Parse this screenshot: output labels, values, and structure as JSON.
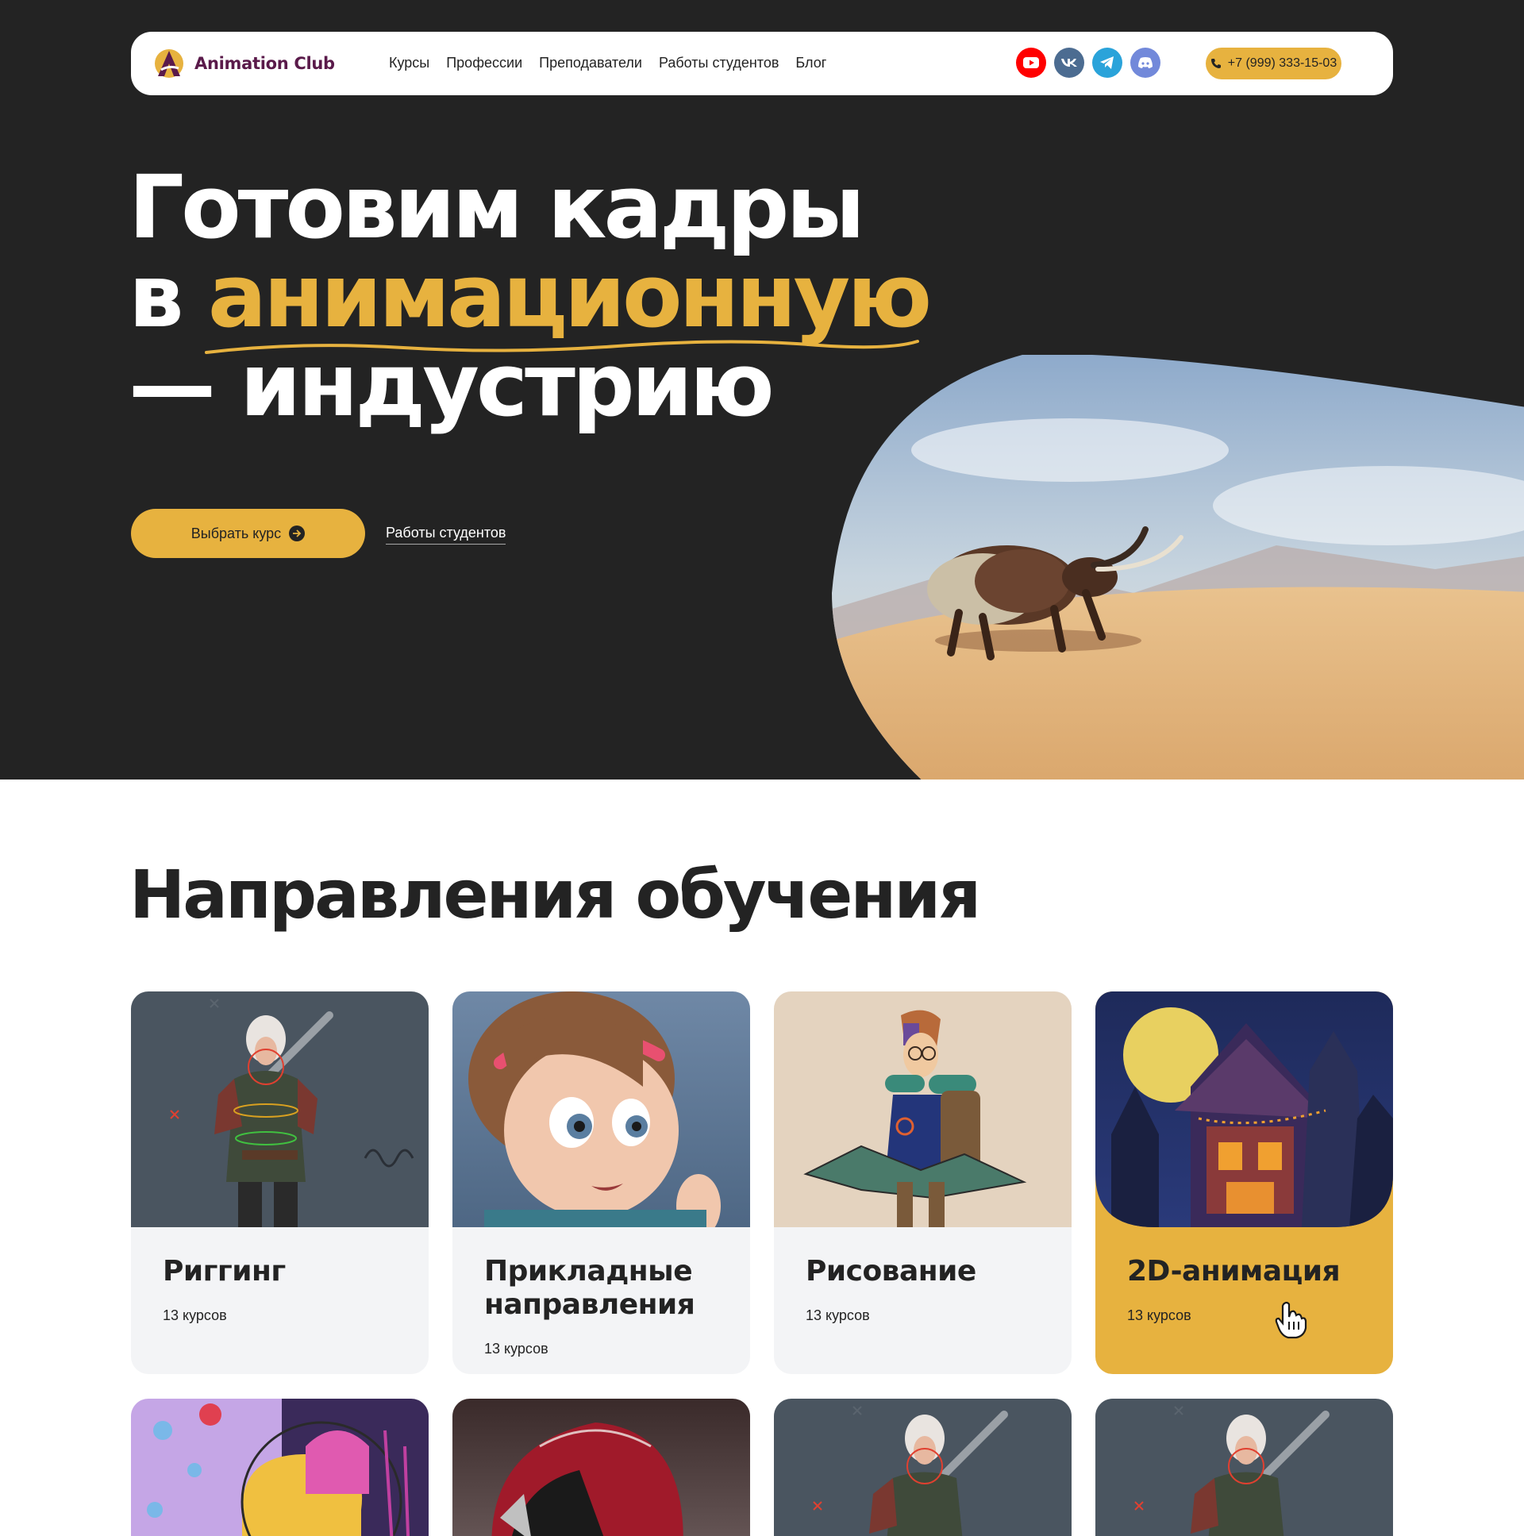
{
  "colors": {
    "dark": "#232323",
    "accent": "#e7b23f",
    "card_bg": "#f3f4f6",
    "logo": "#5a1a4a"
  },
  "header": {
    "logo_text": "Animation Club",
    "nav": [
      "Курсы",
      "Профессии",
      "Преподаватели",
      "Работы студентов",
      "Блог"
    ],
    "socials": [
      "youtube-icon",
      "vk-icon",
      "telegram-icon",
      "discord-icon"
    ],
    "phone": "+7 (999) 333-15-03"
  },
  "hero": {
    "title_line1": "Готовим кадры",
    "title_line2_prefix": "в ",
    "title_line2_accent": "анимационную",
    "title_line3": "— индустрию",
    "cta_primary": "Выбрать курс",
    "cta_secondary": "Работы студентов"
  },
  "directions": {
    "title": "Направления обучения",
    "cards": [
      {
        "title": "Риггинг",
        "count": "13 курсов"
      },
      {
        "title": "Прикладные направления",
        "count": "13 курсов"
      },
      {
        "title": "Рисование",
        "count": "13 курсов"
      },
      {
        "title": "2D-анимация",
        "count": "13 курсов"
      }
    ]
  }
}
